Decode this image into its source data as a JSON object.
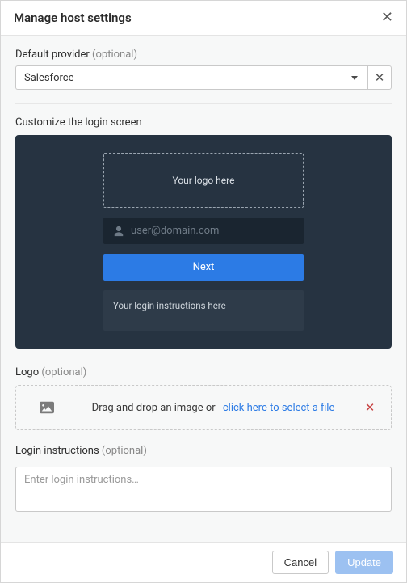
{
  "header": {
    "title": "Manage host settings"
  },
  "provider": {
    "label": "Default provider",
    "optional": "(optional)",
    "value": "Salesforce"
  },
  "customize": {
    "label": "Customize the login screen"
  },
  "preview": {
    "logo_placeholder": "Your logo here",
    "email_placeholder": "user@domain.com",
    "next_label": "Next",
    "instructions_placeholder": "Your login instructions here"
  },
  "logo": {
    "label": "Logo",
    "optional": "(optional)",
    "drop_text": "Drag and drop an image or",
    "select_link": "click here to select a file"
  },
  "instructions": {
    "label": "Login instructions",
    "optional": "(optional)",
    "placeholder": "Enter login instructions…"
  },
  "footer": {
    "cancel": "Cancel",
    "update": "Update"
  }
}
